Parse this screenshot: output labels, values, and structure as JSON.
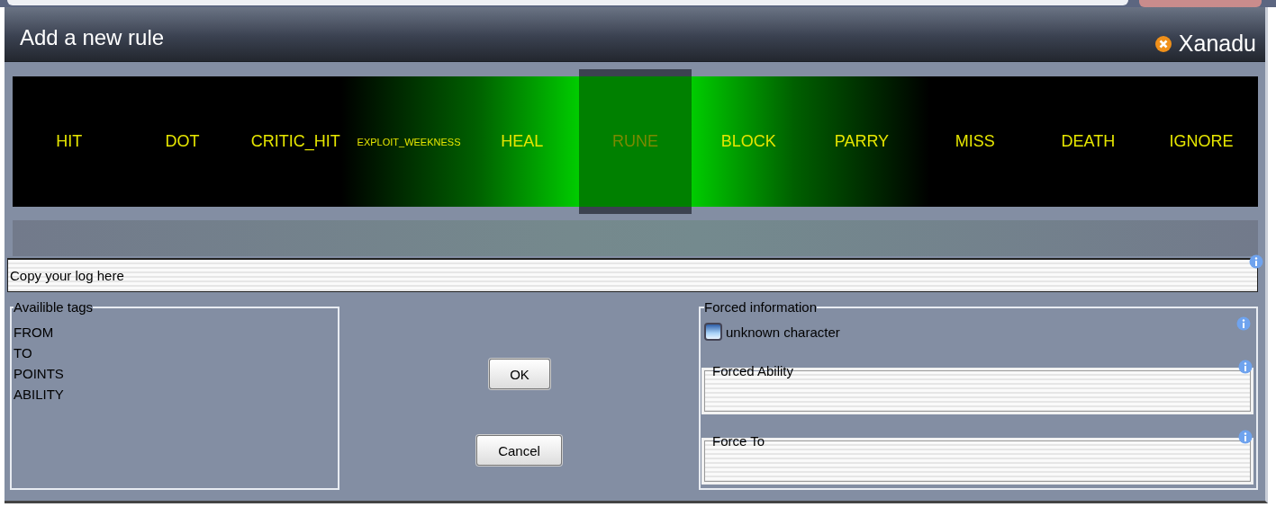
{
  "window": {
    "title": "Add a new rule",
    "app_name": "Xanadu"
  },
  "rule_types": [
    {
      "label": "HIT",
      "selected": false
    },
    {
      "label": "DOT",
      "selected": false
    },
    {
      "label": "CRITIC_HIT",
      "selected": false
    },
    {
      "label": "EXPLOIT_WEEKNESS",
      "selected": false
    },
    {
      "label": "HEAL",
      "selected": false
    },
    {
      "label": "RUNE",
      "selected": true
    },
    {
      "label": "BLOCK",
      "selected": false
    },
    {
      "label": "PARRY",
      "selected": false
    },
    {
      "label": "MISS",
      "selected": false
    },
    {
      "label": "DEATH",
      "selected": false
    },
    {
      "label": "IGNORE",
      "selected": false
    }
  ],
  "log_field": {
    "placeholder": "Copy your log here"
  },
  "available_tags": {
    "title": "Availible tags",
    "items": [
      "FROM",
      "TO",
      "POINTS",
      "ABILITY"
    ]
  },
  "buttons": [
    "OK",
    "Cancel"
  ],
  "forced_information": {
    "title": "Forced information",
    "unknown_character": {
      "label": "unknown character",
      "checked": false
    },
    "fields": [
      {
        "label": "Forced Ability"
      },
      {
        "label": "Force To"
      }
    ]
  }
}
